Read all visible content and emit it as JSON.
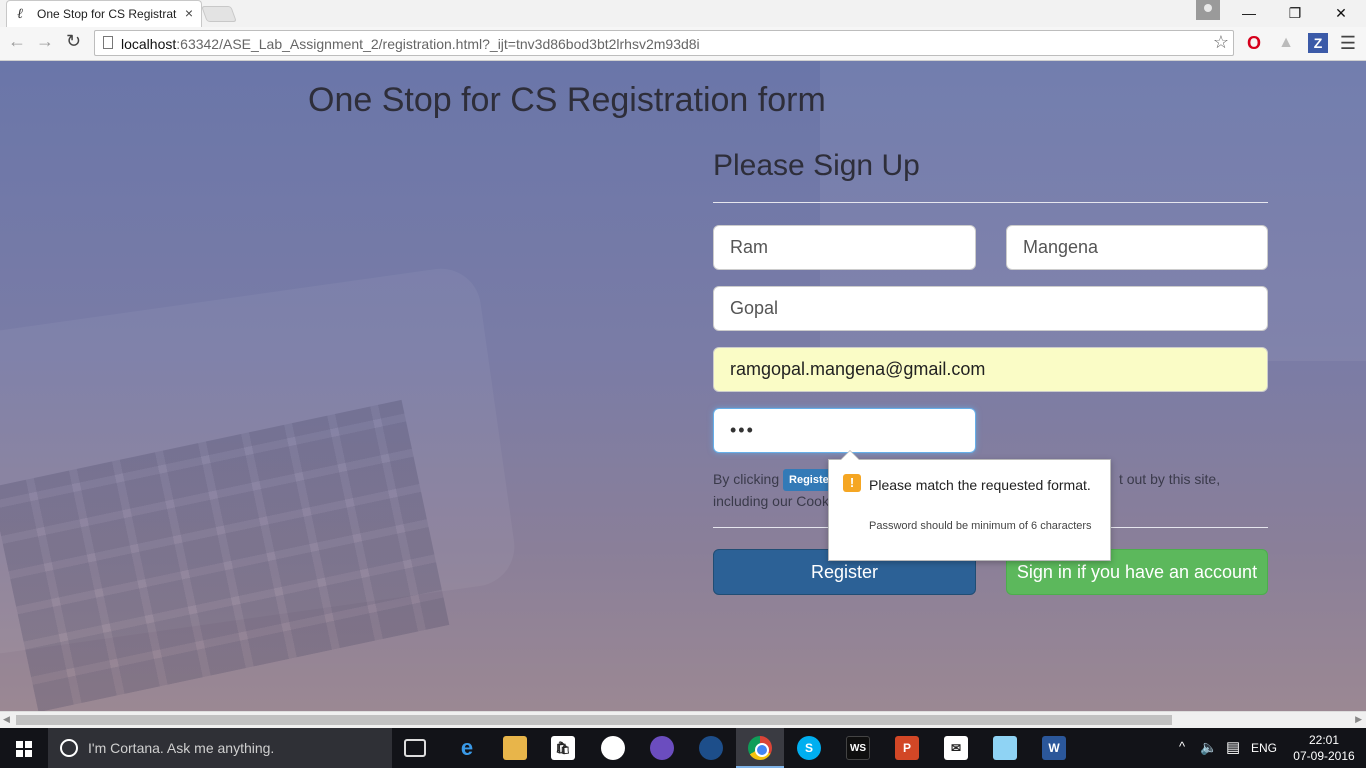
{
  "browser": {
    "tab_title": "One Stop for CS Registrat",
    "tab_favicon": "ℓ",
    "tab_close": "×",
    "url_host": "localhost",
    "url_rest": ":63342/ASE_Lab_Assignment_2/registration.html?_ijt=tnv3d86bod3bt2lrhsv2m93d8i",
    "ext_z_label": "Z",
    "window_controls": {
      "minimize": "—",
      "maximize": "❐",
      "close": "✕"
    }
  },
  "page": {
    "title": "One Stop for CS Registration form",
    "form_heading": "Please Sign Up",
    "fields": {
      "first_name": "Ram",
      "last_name": "Mangena",
      "display_name": "Gopal",
      "email": "ramgopal.mangena@gmail.com",
      "password": "•••"
    },
    "terms": {
      "prefix": "By clicking ",
      "badge": "Register",
      "suffix": " t out by this site,",
      "line2": "including our Cook"
    },
    "buttons": {
      "register": "Register",
      "sign_in": "Sign in if you have an account"
    },
    "validation_tooltip": {
      "icon": "!",
      "message": "Please match the requested format.",
      "detail": "Password should be minimum of 6 characters"
    }
  },
  "taskbar": {
    "cortana_placeholder": "I'm Cortana. Ask me anything.",
    "language": "ENG",
    "time": "22:01",
    "date": "07-09-2016",
    "app_labels": {
      "ws": "WS",
      "ppt": "P",
      "word": "W",
      "store": "🛍",
      "skype": "S"
    }
  },
  "colors": {
    "register_button": "#2c6196",
    "signin_button": "#5cb85c",
    "email_autofill_bg": "#fafcc6",
    "focus_ring": "#66afe9",
    "warning_icon": "#f5a623"
  },
  "icons": [
    "back-arrow-icon",
    "forward-arrow-icon",
    "reload-icon",
    "page-icon",
    "star-icon",
    "opera-icon",
    "drive-icon",
    "z-extension-icon",
    "menu-icon",
    "warning-icon",
    "windows-start-icon",
    "cortana-icon",
    "chrome-icon"
  ]
}
